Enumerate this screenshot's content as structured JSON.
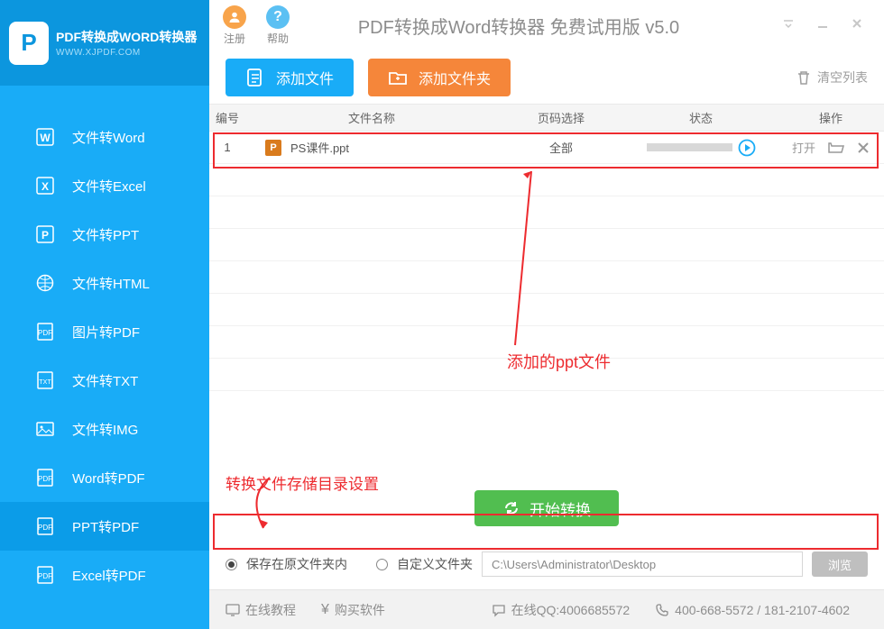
{
  "logo": {
    "title": "PDF转换成WORD转换器",
    "url": "WWW.XJPDF.COM",
    "mark": "P"
  },
  "titlebar": {
    "register": "注册",
    "help": "帮助",
    "app_title": "PDF转换成Word转换器 免费试用版 v5.0"
  },
  "nav": [
    {
      "label": "文件转Word"
    },
    {
      "label": "文件转Excel"
    },
    {
      "label": "文件转PPT"
    },
    {
      "label": "文件转HTML"
    },
    {
      "label": "图片转PDF"
    },
    {
      "label": "文件转TXT"
    },
    {
      "label": "文件转IMG"
    },
    {
      "label": "Word转PDF"
    },
    {
      "label": "PPT转PDF"
    },
    {
      "label": "Excel转PDF"
    }
  ],
  "toolbar": {
    "add_file": "添加文件",
    "add_folder": "添加文件夹",
    "clear": "清空列表"
  },
  "table": {
    "headers": {
      "idx": "编号",
      "name": "文件名称",
      "page": "页码选择",
      "status": "状态",
      "action": "操作"
    },
    "rows": [
      {
        "idx": "1",
        "file_icon": "P",
        "name": "PS课件.ppt",
        "page": "全部",
        "open": "打开"
      }
    ]
  },
  "annotations": {
    "added_file": "添加的ppt文件",
    "save_dir": "转换文件存储目录设置"
  },
  "actions": {
    "start": "开始转换",
    "browse": "浏览"
  },
  "save": {
    "opt_original": "保存在原文件夹内",
    "opt_custom": "自定义文件夹",
    "path": "C:\\Users\\Administrator\\Desktop"
  },
  "status": {
    "tutorial": "在线教程",
    "buy": "购买软件",
    "qq": "在线QQ:4006685572",
    "tel": "400-668-5572 / 181-2107-4602"
  }
}
